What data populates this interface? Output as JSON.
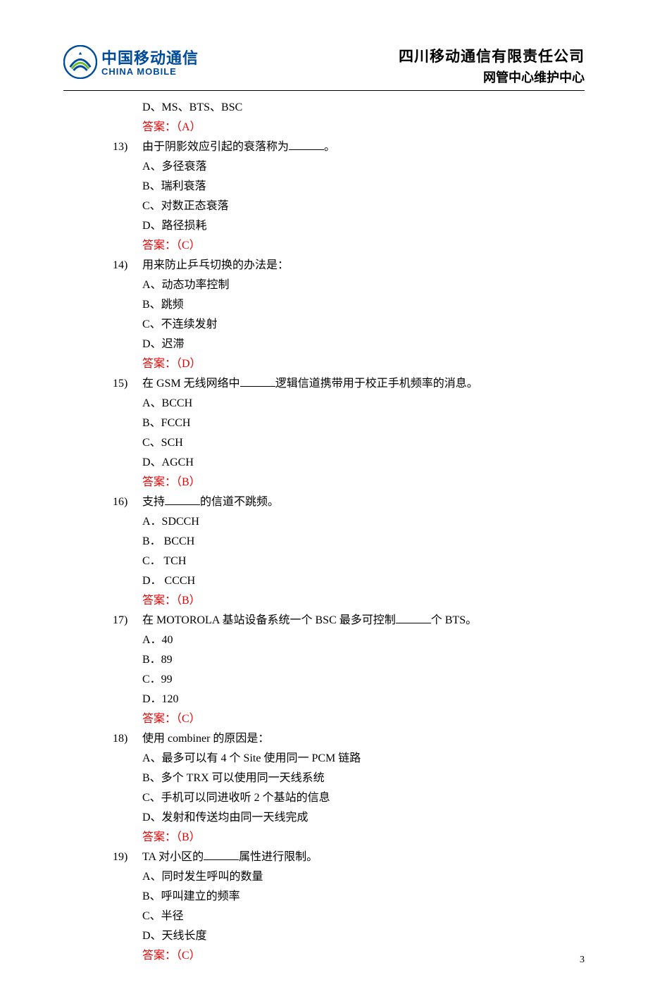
{
  "header": {
    "logo_cn": "中国移动通信",
    "logo_en": "CHINA MOBILE",
    "company": "四川移动通信有限责任公司",
    "dept": "网管中心维护中心"
  },
  "remnant": {
    "opt_d": "D、MS、BTS、BSC",
    "answer": "答案：（A）"
  },
  "questions": [
    {
      "num": "13)",
      "text_pre": "由于阴影效应引起的衰落称为",
      "text_post": "。",
      "opts": [
        "A、多径衰落",
        "B、瑞利衰落",
        "C、对数正态衰落",
        "D、路径损耗"
      ],
      "answer": "答案：（C）"
    },
    {
      "num": "14)",
      "text_pre": "用来防止乒乓切换的办法是：",
      "text_post": "",
      "opts": [
        "A、动态功率控制",
        "B、跳频",
        "C、不连续发射",
        "D、迟滞"
      ],
      "answer": "答案：（D）"
    },
    {
      "num": "15)",
      "text_pre": "在 GSM 无线网络中",
      "text_post": "逻辑信道携带用于校正手机频率的消息。",
      "opts": [
        "A、BCCH",
        "B、FCCH",
        "C、SCH",
        "D、AGCH"
      ],
      "answer": "答案：（B）"
    },
    {
      "num": "16)",
      "text_pre": "支持",
      "text_post": "的信道不跳频。",
      "opts": [
        "A．SDCCH",
        "B．  BCCH",
        "C．  TCH",
        "D．  CCCH"
      ],
      "answer": "答案：（B）"
    },
    {
      "num": "17)",
      "text_pre": "在 MOTOROLA 基站设备系统一个 BSC 最多可控制",
      "text_post": "个 BTS。",
      "opts": [
        "A．40",
        "B．89",
        "C．99",
        "D．120"
      ],
      "answer": "答案：（C）"
    },
    {
      "num": "18)",
      "text_pre": "使用 combiner 的原因是：",
      "text_post": "",
      "opts": [
        "A、最多可以有 4 个 Site 使用同一 PCM 链路",
        "B、多个 TRX 可以使用同一天线系统",
        "C、手机可以同进收听 2 个基站的信息",
        "D、发射和传送均由同一天线完成"
      ],
      "answer": "答案：（B）"
    },
    {
      "num": "19)",
      "text_pre": "TA 对小区的",
      "text_post": "属性进行限制。",
      "opts": [
        "A、同时发生呼叫的数量",
        "B、呼叫建立的频率",
        "C、半径",
        "D、天线长度"
      ],
      "answer": "答案：（C）"
    }
  ],
  "page_num": "3"
}
